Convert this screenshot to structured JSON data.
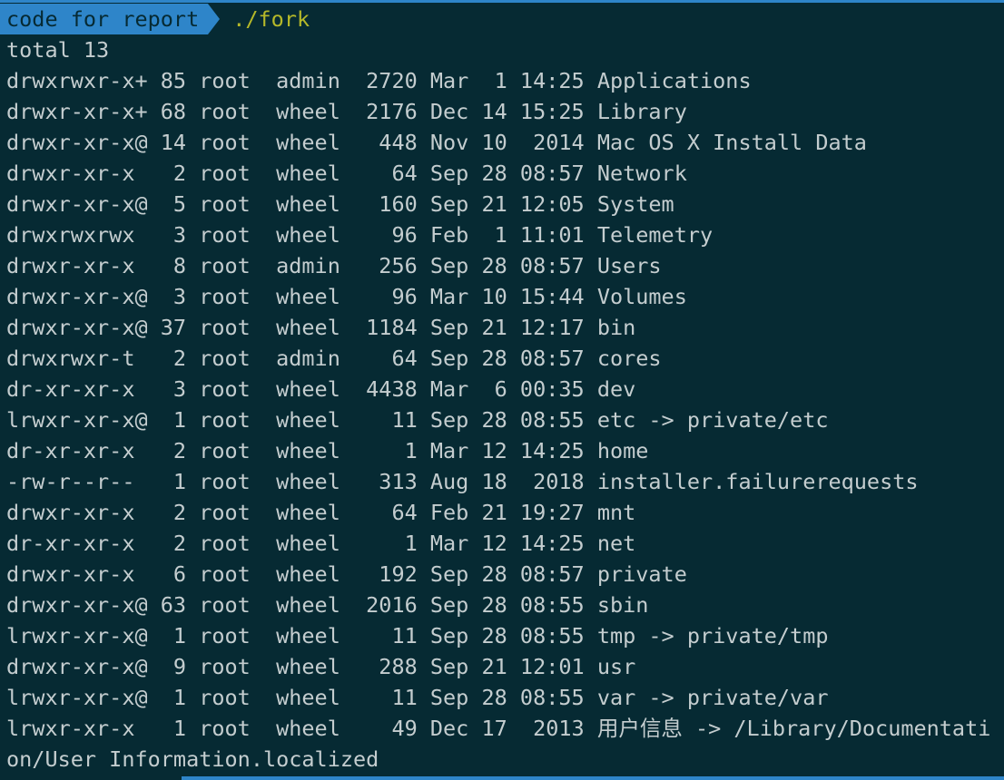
{
  "prompt": {
    "segment": "code for report",
    "command": "./fork"
  },
  "output_lines": [
    "total 13",
    "drwxrwxr-x+ 85 root  admin  2720 Mar  1 14:25 Applications",
    "drwxr-xr-x+ 68 root  wheel  2176 Dec 14 15:25 Library",
    "drwxr-xr-x@ 14 root  wheel   448 Nov 10  2014 Mac OS X Install Data",
    "drwxr-xr-x   2 root  wheel    64 Sep 28 08:57 Network",
    "drwxr-xr-x@  5 root  wheel   160 Sep 21 12:05 System",
    "drwxrwxrwx   3 root  wheel    96 Feb  1 11:01 Telemetry",
    "drwxr-xr-x   8 root  admin   256 Sep 28 08:57 Users",
    "drwxr-xr-x@  3 root  wheel    96 Mar 10 15:44 Volumes",
    "drwxr-xr-x@ 37 root  wheel  1184 Sep 21 12:17 bin",
    "drwxrwxr-t   2 root  admin    64 Sep 28 08:57 cores",
    "dr-xr-xr-x   3 root  wheel  4438 Mar  6 00:35 dev",
    "lrwxr-xr-x@  1 root  wheel    11 Sep 28 08:55 etc -> private/etc",
    "dr-xr-xr-x   2 root  wheel     1 Mar 12 14:25 home",
    "-rw-r--r--   1 root  wheel   313 Aug 18  2018 installer.failurerequests",
    "drwxr-xr-x   2 root  wheel    64 Feb 21 19:27 mnt",
    "dr-xr-xr-x   2 root  wheel     1 Mar 12 14:25 net",
    "drwxr-xr-x   6 root  wheel   192 Sep 28 08:57 private",
    "drwxr-xr-x@ 63 root  wheel  2016 Sep 28 08:55 sbin",
    "lrwxr-xr-x@  1 root  wheel    11 Sep 28 08:55 tmp -> private/tmp",
    "drwxr-xr-x@  9 root  wheel   288 Sep 21 12:01 usr",
    "lrwxr-xr-x@  1 root  wheel    11 Sep 28 08:55 var -> private/var",
    "lrwxr-xr-x   1 root  wheel    49 Dec 17  2013 用户信息 -> /Library/Documentati",
    "on/User Information.localized"
  ]
}
